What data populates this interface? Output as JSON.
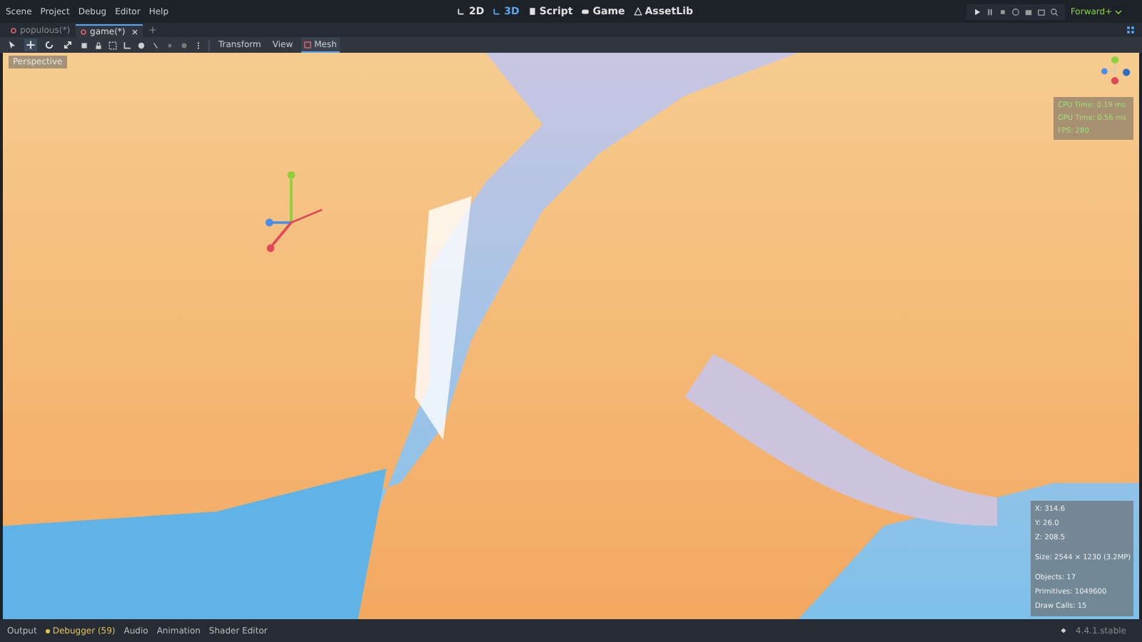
{
  "menus": [
    "Scene",
    "Project",
    "Debug",
    "Editor",
    "Help"
  ],
  "workspaces": [
    {
      "kind": "planar",
      "label": "2D",
      "selected": false
    },
    {
      "kind": "spatial",
      "label": "3D",
      "selected": true
    },
    {
      "kind": "script",
      "label": "Script",
      "selected": false
    },
    {
      "kind": "game",
      "label": "Game",
      "selected": false
    },
    {
      "kind": "assetlib",
      "label": "AssetLib",
      "selected": false
    }
  ],
  "renderer": "Forward+",
  "tabs": [
    {
      "label": "populous(*)",
      "selected": false
    },
    {
      "label": "game(*)",
      "selected": true
    }
  ],
  "tools": [
    {
      "kind": "select",
      "selected": false
    },
    {
      "kind": "move",
      "selected": true
    },
    {
      "kind": "rotate",
      "selected": false
    },
    {
      "kind": "scale",
      "selected": false
    }
  ],
  "toolbar_menus": [
    {
      "label": "Transform",
      "selected": false
    },
    {
      "label": "View",
      "selected": false
    },
    {
      "label": "Mesh",
      "selected": true
    }
  ],
  "viewport": {
    "label": "Perspective",
    "frame_stats": [
      "CPU Time: 0.19 ms",
      "GPU Time: 0.56 ms",
      "FPS: 280"
    ],
    "info_groups": [
      [
        "X: 314.6",
        "Y: 26.0",
        "Z: 208.5"
      ],
      [
        "Size: 2544 × 1230 (3.2MP)"
      ],
      [
        "Objects: 17",
        "Primitives: 1049600",
        "Draw Calls: 15"
      ]
    ]
  },
  "bottom_tabs": [
    {
      "label": "Output",
      "alert": false
    },
    {
      "label": "Debugger (59)",
      "alert": true
    },
    {
      "label": "Audio",
      "alert": false
    },
    {
      "label": "Animation",
      "alert": false
    },
    {
      "label": "Shader Editor",
      "alert": false
    }
  ],
  "version": "4.4.1.stable"
}
